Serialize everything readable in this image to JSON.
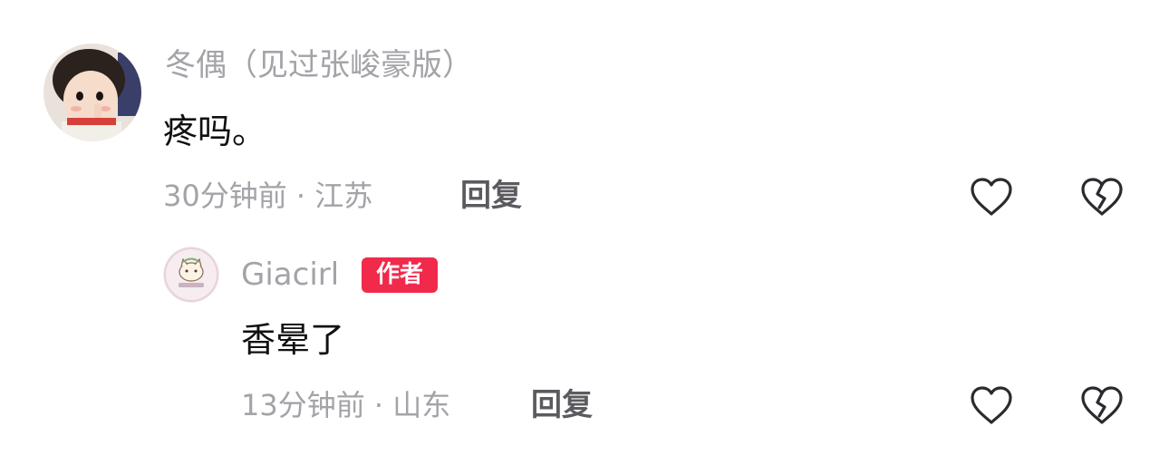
{
  "comments": [
    {
      "username": "冬偶（见过张峻豪版）",
      "content": "疼吗。",
      "meta": "30分钟前 · 江苏",
      "reply_label": "回复",
      "avatar": "baby-photo-avatar"
    },
    {
      "username": "Giacirl",
      "badge": "作者",
      "content": "香晕了",
      "meta": "13分钟前 · 山东",
      "reply_label": "回复",
      "avatar": "cat-illustration-avatar"
    }
  ],
  "icons": {
    "like": "heart-outline-icon",
    "dislike": "broken-heart-icon"
  },
  "colors": {
    "author_badge": "#f1294b",
    "secondary_text": "#a3a3a8",
    "primary_text": "#111111",
    "reply_text": "#5a5a5f"
  }
}
